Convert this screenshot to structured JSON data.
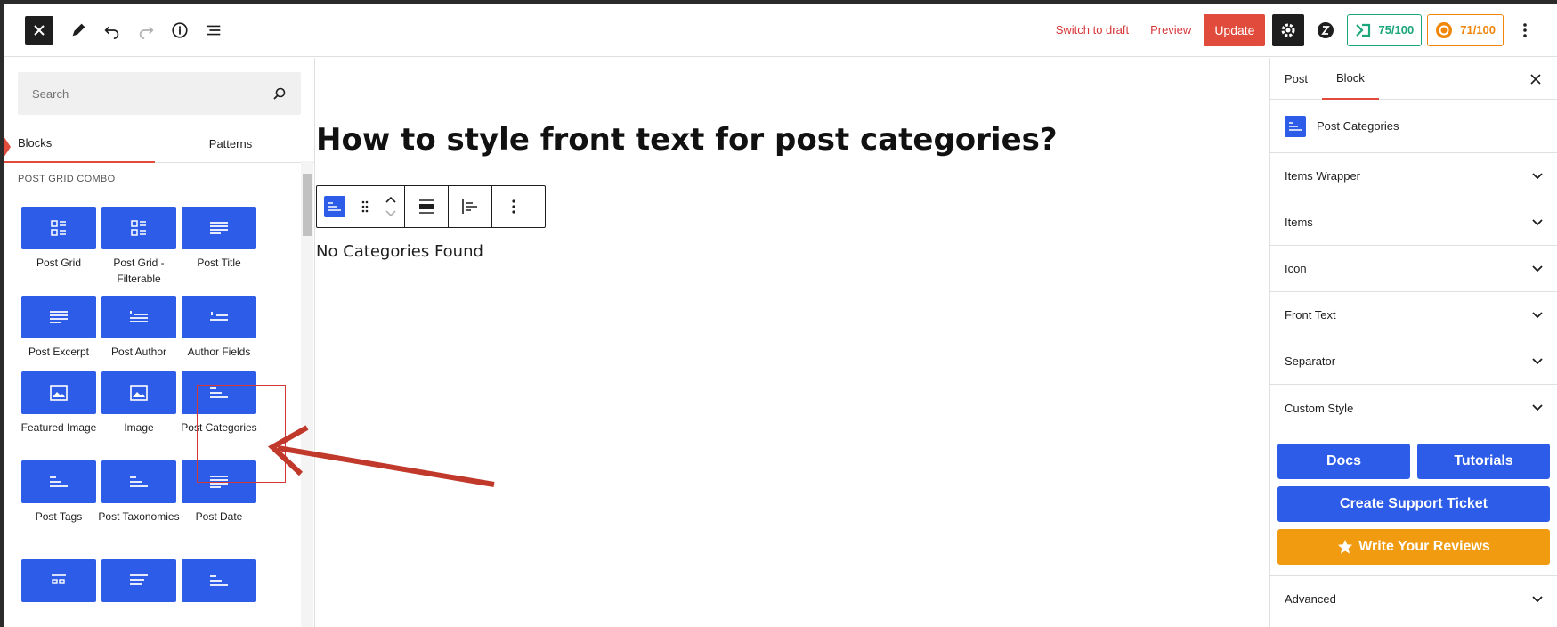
{
  "toolbar": {
    "switch_draft": "Switch to draft",
    "preview": "Preview",
    "update": "Update",
    "score_green": "75/100",
    "score_orange": "71/100",
    "colors": {
      "accent_red": "#e04b3b",
      "score_green": "#1aa57a",
      "score_orange": "#f0860a"
    }
  },
  "inserter": {
    "search_placeholder": "Search",
    "tabs": [
      "Blocks",
      "Patterns"
    ],
    "category": "POST GRID COMBO",
    "blocks": [
      {
        "label": "Post Grid",
        "icon": "grid-icon"
      },
      {
        "label": "Post Grid - Filterable",
        "icon": "grid-icon"
      },
      {
        "label": "Post Title",
        "icon": "lines-icon"
      },
      {
        "label": "Post Excerpt",
        "icon": "lines-icon"
      },
      {
        "label": "Post Author",
        "icon": "list-icon"
      },
      {
        "label": "Author Fields",
        "icon": "list-icon"
      },
      {
        "label": "Featured Image",
        "icon": "image-icon"
      },
      {
        "label": "Image",
        "icon": "image-icon"
      },
      {
        "label": "Post Categories",
        "icon": "categories-icon"
      },
      {
        "label": "Post Tags",
        "icon": "categories-icon"
      },
      {
        "label": "Post Taxonomies",
        "icon": "categories-icon"
      },
      {
        "label": "Post Date",
        "icon": "lines-icon"
      }
    ]
  },
  "canvas": {
    "post_title": "How to style front text for post categories?",
    "empty_message": "No Categories Found"
  },
  "sidebar": {
    "tabs": [
      "Post",
      "Block"
    ],
    "block_name": "Post Categories",
    "panels": [
      "Items Wrapper",
      "Items",
      "Icon",
      "Front Text",
      "Separator",
      "Custom Style"
    ],
    "docs": "Docs",
    "tutorials": "Tutorials",
    "support": "Create Support Ticket",
    "reviews": "Write Your Reviews",
    "advanced": "Advanced"
  }
}
